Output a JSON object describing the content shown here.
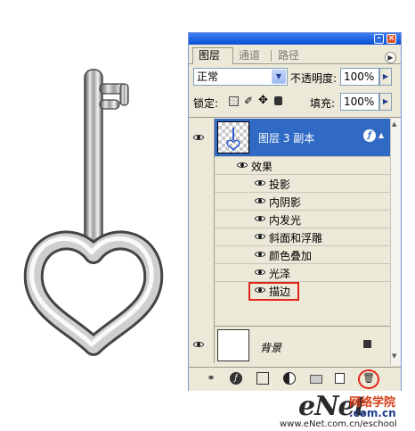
{
  "panel": {
    "tabs": [
      {
        "label": "图层"
      },
      {
        "label": "通道"
      },
      {
        "label": "路径"
      }
    ],
    "blend_mode": "正常",
    "opacity_label": "不透明度:",
    "opacity_value": "100%",
    "lock_label": "锁定:",
    "fill_label": "填充:",
    "fill_value": "100%"
  },
  "layers": {
    "copy_layer_name": "图层 3 副本",
    "effects_label": "效果",
    "effects": [
      "投影",
      "内阴影",
      "内发光",
      "斜面和浮雕",
      "颜色叠加",
      "光泽",
      "描边"
    ],
    "background_name": "背景"
  },
  "watermark": {
    "enet": "eNet",
    "cn": "网络学院",
    "dotcom": ".com.cn",
    "url": "www.eNet.com.cn/eschool"
  },
  "colors": {
    "selection": "#316ac5",
    "highlight_red": "#e2231a",
    "panel_bg": "#ece9d8",
    "titlebar": "#0a4fd6"
  },
  "icons": {
    "close": "close-icon",
    "minimize": "minimize-icon",
    "panel_menu": "panel-menu-arrow-icon",
    "trash": "trash-icon"
  }
}
